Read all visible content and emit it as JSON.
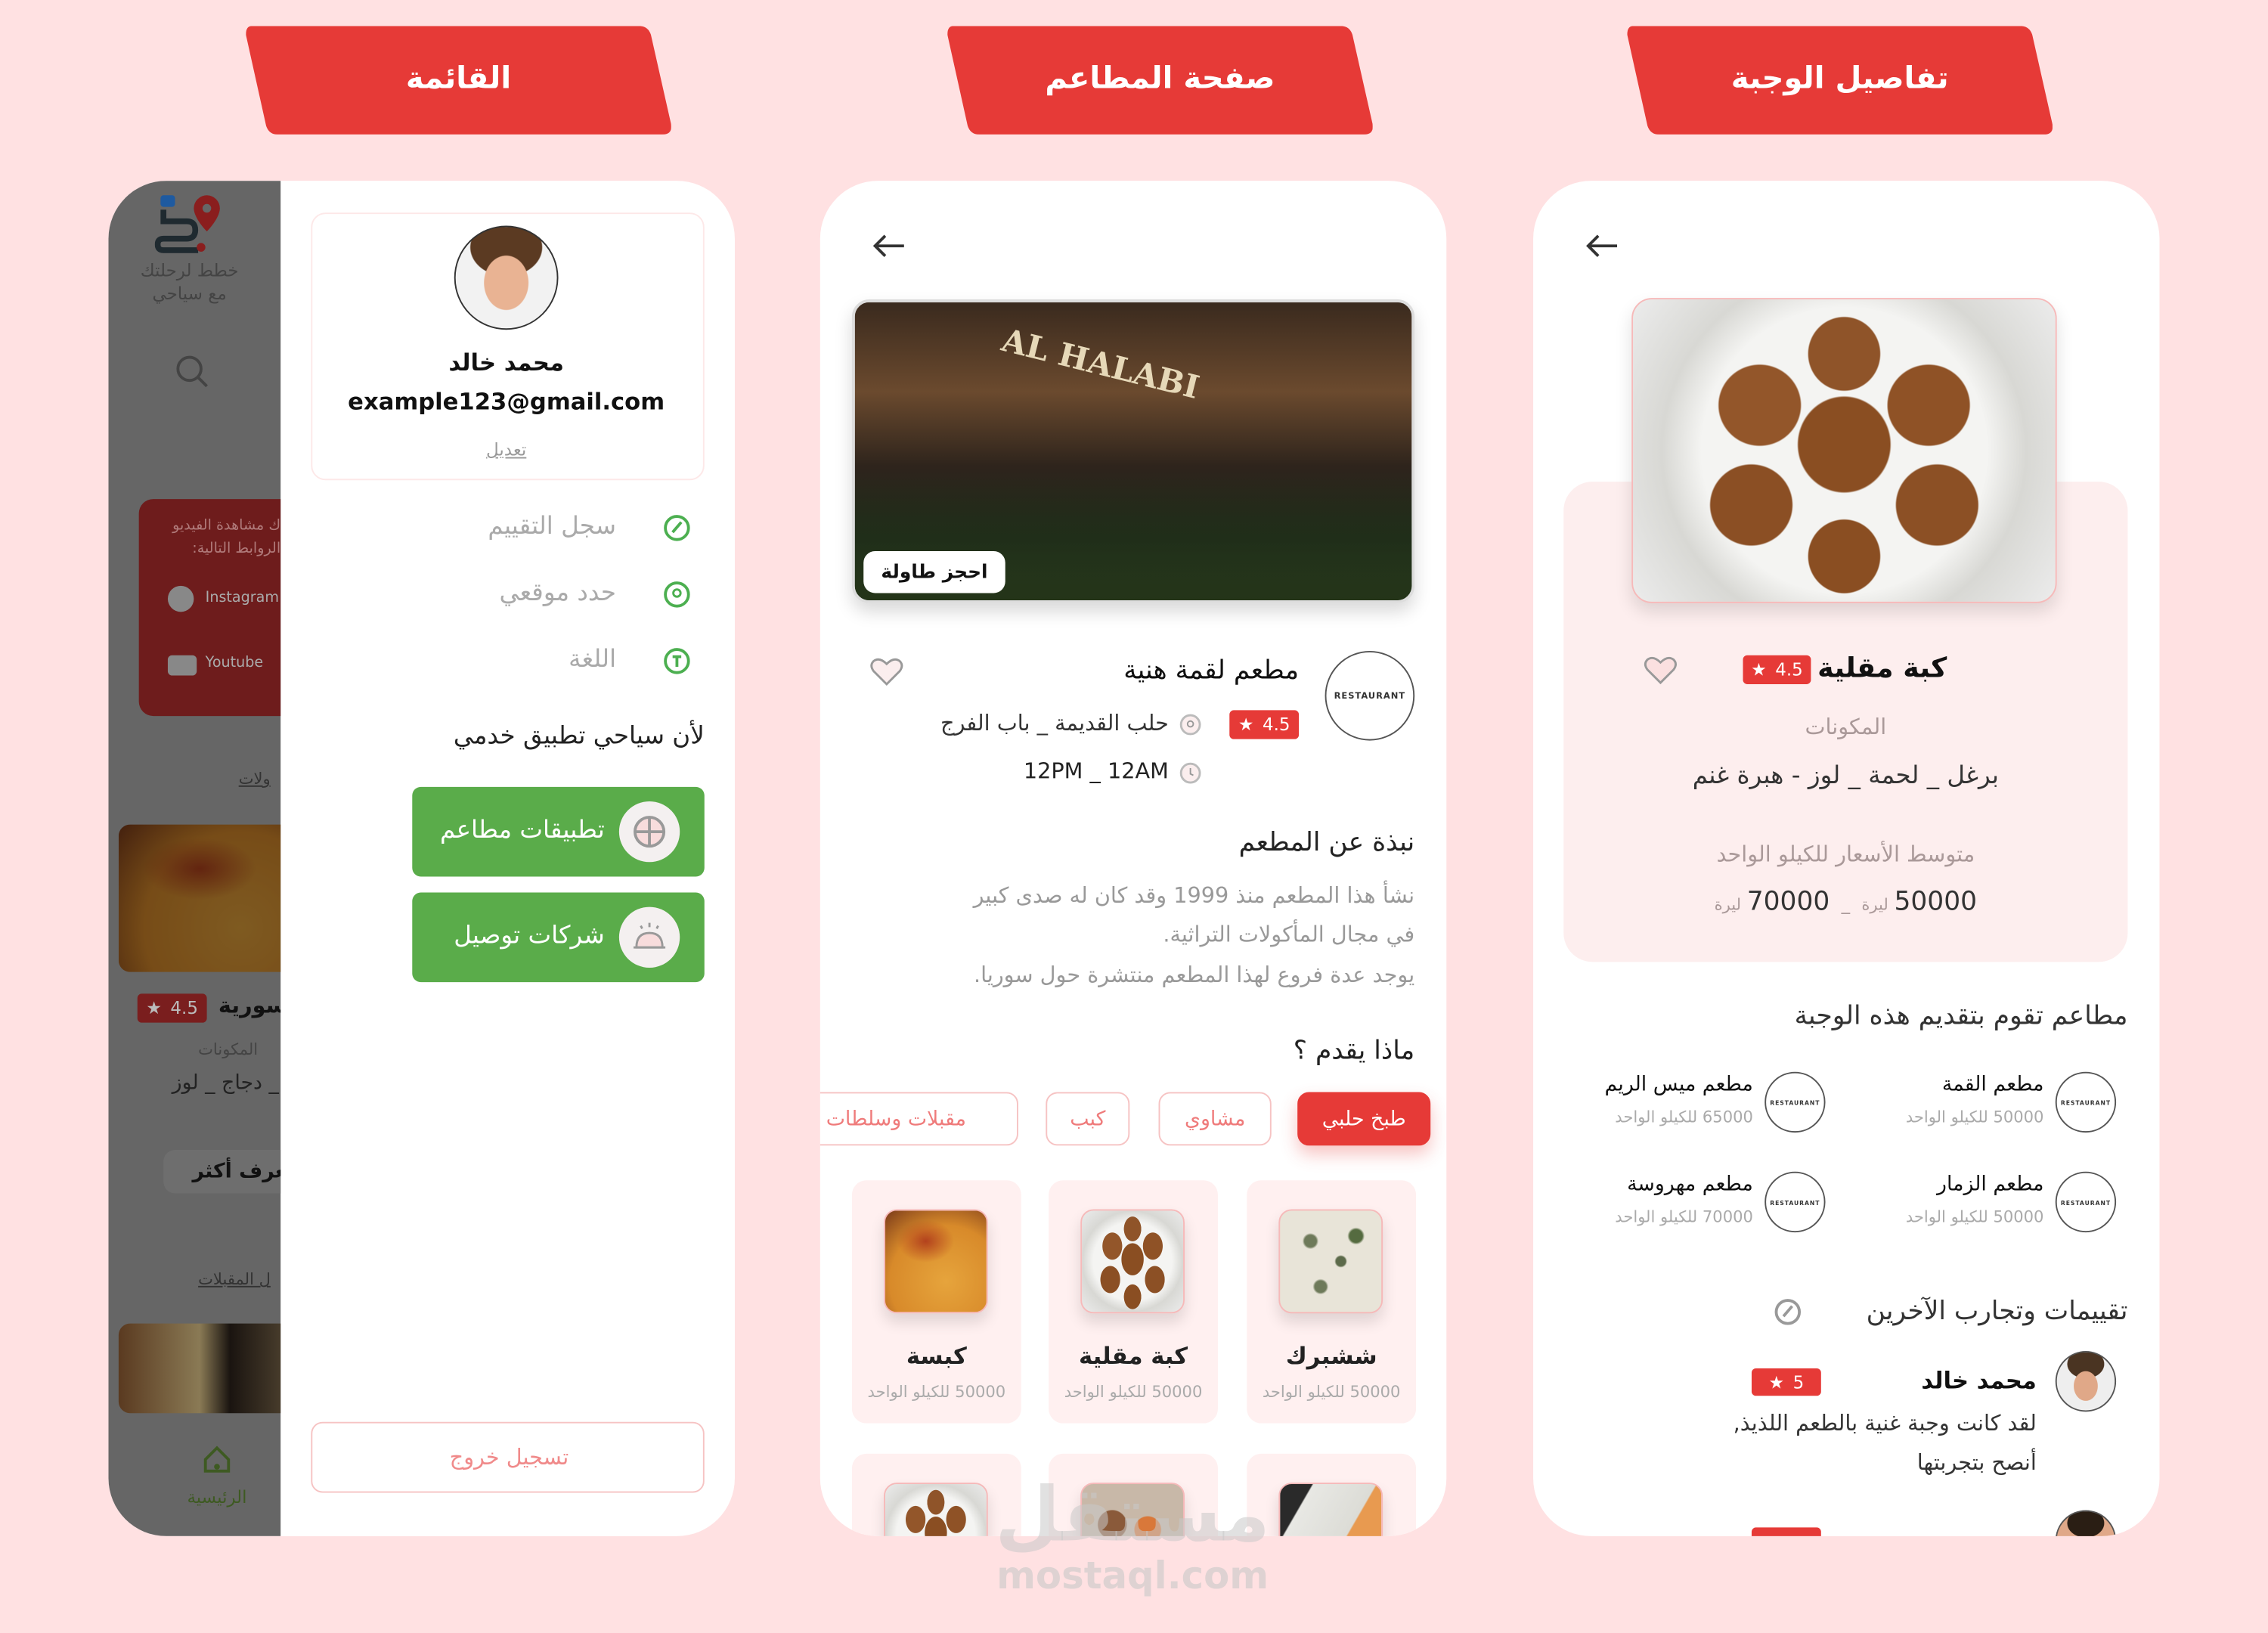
{
  "colors": {
    "accent": "#e63a37",
    "green": "#5aac4a",
    "background": "#ffe1e2",
    "panel": "#fdeeee"
  },
  "tabs": [
    {
      "label": "القائمة"
    },
    {
      "label": "صفحة المطاعم"
    },
    {
      "label": "تفاصيل الوجبة"
    }
  ],
  "menu_screen": {
    "background_app": {
      "tagline_1": "خطط لرحلتك",
      "tagline_2": "مع سياحي",
      "social_text_1": "ك مشاهدة الفيديو",
      "social_text_2": "الروابط التالية:",
      "instagram": "Instagram",
      "youtube": "Youtube",
      "link_1": "ولات",
      "dish_name": "سورية",
      "dish_rating": "4.5",
      "ingredients_label": "المكونات",
      "ingredients": "ز _ دجاج _ لوز",
      "learn_more": "تعرف أكثر",
      "link_2": "ل المقبلات",
      "nav_home": "الرئيسية"
    },
    "profile": {
      "name": "محمد خالد",
      "email": "example123@gmail.com",
      "edit": "تعديل"
    },
    "items": [
      {
        "label": "سجل التقييم",
        "icon": "edit-icon"
      },
      {
        "label": "حدد موقعي",
        "icon": "location-icon"
      },
      {
        "label": "اللغة",
        "icon": "language-icon"
      }
    ],
    "services_heading": "لأن سياحي تطبيق خدمي",
    "service_buttons": [
      {
        "label": "تطبيقات مطاعم",
        "icon": "restaurant-icon"
      },
      {
        "label": "شركات توصيل",
        "icon": "food-cover-icon"
      }
    ],
    "logout": "تسجيل خروج"
  },
  "restaurant_screen": {
    "book_table": "احجز طاولة",
    "photo_sign": "AL HALABI",
    "logo_text": "RESTAURANT",
    "name": "مطعم لقمة هنية",
    "rating": "4.5",
    "location": "حلب القديمة _ باب الفرج",
    "hours": "12PM _ 12AM",
    "about_heading": "نبذة عن المطعم",
    "about_lines": [
      "نشأ هذا المطعم منذ 1999 وقد كان له صدى كبير",
      "في مجال المأكولات التراثية.",
      "يوجد عدة فروع لهذا المطعم منتشرة حول سوريا."
    ],
    "offers_heading": "ماذا يقدم ؟",
    "categories": [
      {
        "label": "طبخ حلبي",
        "active": true
      },
      {
        "label": "مشاوي",
        "active": false
      },
      {
        "label": "كبب",
        "active": false
      },
      {
        "label": "مقبلات وسلطات م",
        "active": false
      }
    ],
    "dishes": [
      {
        "name": "ششبرك",
        "price": "50000 للكيلو الواحد"
      },
      {
        "name": "كبة مقلية",
        "price": "50000 للكيلو الواحد"
      },
      {
        "name": "كبسة",
        "price": "50000 للكيلو الواحد"
      }
    ]
  },
  "dish_screen": {
    "name": "كبة مقلية",
    "rating": "4.5",
    "ingredients_label": "المكونات",
    "ingredients": "برغل _ لحمة _ لوز - هبرة غنم",
    "avg_price_label": "متوسط الأسعار للكيلو الواحد",
    "price_min": "50000",
    "price_max": "70000",
    "currency": "ليرة",
    "price_sep": "_",
    "restaurants_heading": "مطاعم تقوم بتقديم هذه الوجبة",
    "restaurants": [
      {
        "name": "مطعم القمة",
        "price": "50000 للكيلو الواحد"
      },
      {
        "name": "مطعم ميس الريم",
        "price": "65000 للكيلو الواحد"
      },
      {
        "name": "مطعم الزمار",
        "price": "50000 للكيلو الواحد"
      },
      {
        "name": "مطعم مهروسة",
        "price": "70000 للكيلو الواحد"
      }
    ],
    "reviews_heading": "تقييمات وتجارب الآخرين",
    "reviews": [
      {
        "name": "محمد خالد",
        "rating": "5",
        "text_1": "لقد كانت وجبة غنية بالطعم اللذيذ,",
        "text_2": "أنصح بتجربتها"
      }
    ]
  },
  "watermark": {
    "arabic": "مستقل",
    "latin": "mostaql.com"
  }
}
